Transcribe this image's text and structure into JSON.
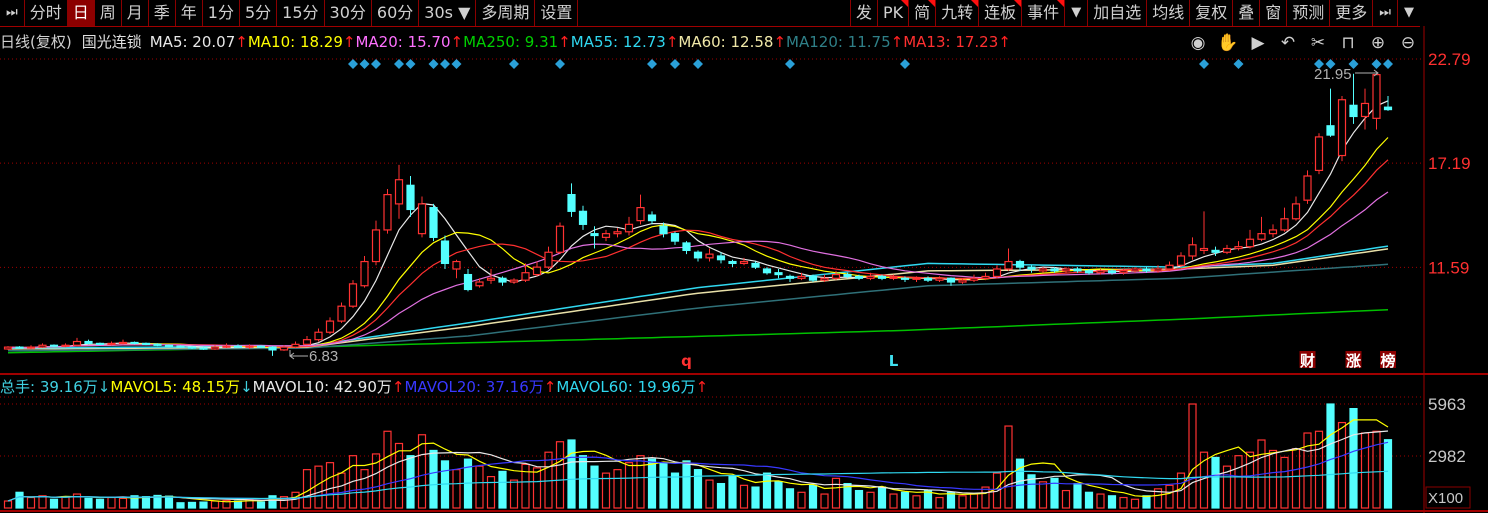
{
  "toolbar": {
    "left": [
      {
        "label": "⏭",
        "name": "collapse-sidebar-button",
        "icon": true
      },
      {
        "label": "分时",
        "name": "tab-intraday"
      },
      {
        "label": "日",
        "name": "tab-daily",
        "active": true
      },
      {
        "label": "周",
        "name": "tab-weekly"
      },
      {
        "label": "月",
        "name": "tab-monthly"
      },
      {
        "label": "季",
        "name": "tab-quarterly"
      },
      {
        "label": "年",
        "name": "tab-yearly"
      },
      {
        "label": "1分",
        "name": "tab-1min"
      },
      {
        "label": "5分",
        "name": "tab-5min"
      },
      {
        "label": "15分",
        "name": "tab-15min"
      },
      {
        "label": "30分",
        "name": "tab-30min"
      },
      {
        "label": "60分",
        "name": "tab-60min"
      },
      {
        "label": "30s   ▼",
        "name": "period-dropdown"
      },
      {
        "label": "多周期",
        "name": "multi-period-button"
      },
      {
        "label": "设置",
        "name": "settings-button"
      }
    ],
    "right": [
      {
        "label": "发",
        "name": "publish-button"
      },
      {
        "label": "PK",
        "name": "pk-button",
        "flag": true
      },
      {
        "label": "简",
        "name": "simple-button",
        "flag": true
      },
      {
        "label": "九转",
        "name": "nine-turn-button",
        "flag": true
      },
      {
        "label": "连板",
        "name": "consecutive-limit-button",
        "flag": true
      },
      {
        "label": "事件",
        "name": "events-button",
        "flag": true
      },
      {
        "label": "▼",
        "name": "more-dropdown",
        "icon": true
      },
      {
        "label": "加自选",
        "name": "add-watchlist-button"
      },
      {
        "label": "均线",
        "name": "moving-average-button"
      },
      {
        "label": "复权",
        "name": "adjust-button"
      },
      {
        "label": "叠",
        "name": "overlay-button"
      },
      {
        "label": "窗",
        "name": "window-button"
      },
      {
        "label": "预测",
        "name": "forecast-button"
      },
      {
        "label": "更多",
        "name": "more-button"
      },
      {
        "label": "⏭",
        "name": "expand-panel-button",
        "icon": true
      },
      {
        "label": "▼",
        "name": "panel-dropdown",
        "icon": true
      }
    ]
  },
  "price_legend": {
    "period": "日线(复权)",
    "stock": "国光连锁",
    "items": [
      {
        "label": "MA5: 20.07",
        "arrow": "↑",
        "dir": "up",
        "color": "#e8e8e8"
      },
      {
        "label": "MA10: 18.29",
        "arrow": "↑",
        "dir": "up",
        "color": "#ffff00"
      },
      {
        "label": "MA20: 15.70",
        "arrow": "↑",
        "dir": "up",
        "color": "#ff70ff"
      },
      {
        "label": "MA250: 9.31",
        "arrow": "↑",
        "dir": "up",
        "color": "#00d000"
      },
      {
        "label": "MA55: 12.73",
        "arrow": "↑",
        "dir": "up",
        "color": "#30d8f0"
      },
      {
        "label": "MA60: 12.58",
        "arrow": "↑",
        "dir": "up",
        "color": "#f0e8a8"
      },
      {
        "label": "MA120: 11.75",
        "arrow": "↑",
        "dir": "up",
        "color": "#2f8088"
      },
      {
        "label": "MA13: 17.23",
        "arrow": "↑",
        "dir": "up",
        "color": "#ff3030"
      }
    ]
  },
  "tools": [
    {
      "name": "eye-icon",
      "glyph": "◉"
    },
    {
      "name": "hand-icon",
      "glyph": "✋"
    },
    {
      "name": "play-icon",
      "glyph": "▶"
    },
    {
      "name": "undo-icon",
      "glyph": "↶"
    },
    {
      "name": "scissors-icon",
      "glyph": "✂"
    },
    {
      "name": "lock-icon",
      "glyph": "⊓"
    },
    {
      "name": "zoom-in-icon",
      "glyph": "⊕"
    },
    {
      "name": "zoom-out-icon",
      "glyph": "⊖"
    }
  ],
  "vol_legend": {
    "items": [
      {
        "label": "总手: 39.16万",
        "arrow": "↓",
        "dir": "down",
        "color": "#40d0e0"
      },
      {
        "label": "MAVOL5: 48.15万",
        "arrow": "↓",
        "dir": "down",
        "color": "#ffff00"
      },
      {
        "label": "MAVOL10: 42.90万",
        "arrow": "↑",
        "dir": "up",
        "color": "#e8e8e8"
      },
      {
        "label": "MAVOL20: 37.16万",
        "arrow": "↑",
        "dir": "up",
        "color": "#3838ff"
      },
      {
        "label": "MAVOL60: 19.96万",
        "arrow": "↑",
        "dir": "up",
        "color": "#30d8f0"
      }
    ]
  },
  "colors": {
    "up": "#ff3232",
    "down": "#54ffff",
    "grid": "#a00000",
    "axis_text": "#ff3030",
    "vol_axis_text": "#c8c8c8"
  },
  "chart_data": {
    "type": "candlestick",
    "price_axis": {
      "ticks": [
        "22.79",
        "17.19",
        "11.59"
      ],
      "tick_values": [
        22.79,
        17.19,
        11.59
      ]
    },
    "volume_axis": {
      "ticks": [
        "5963",
        "2982"
      ],
      "tick_values": [
        5963,
        2982
      ],
      "unit": "X100"
    },
    "high_label": "21.95",
    "low_label": "6.83",
    "bars_format": [
      "open",
      "close",
      "high",
      "low",
      "volume"
    ],
    "bars": [
      [
        7.2,
        7.3,
        7.35,
        7.15,
        400
      ],
      [
        7.3,
        7.25,
        7.35,
        7.2,
        900
      ],
      [
        7.25,
        7.3,
        7.4,
        7.2,
        600
      ],
      [
        7.3,
        7.4,
        7.5,
        7.25,
        700
      ],
      [
        7.4,
        7.35,
        7.45,
        7.3,
        500
      ],
      [
        7.35,
        7.4,
        7.5,
        7.3,
        650
      ],
      [
        7.4,
        7.6,
        7.8,
        7.35,
        800
      ],
      [
        7.6,
        7.5,
        7.7,
        7.45,
        550
      ],
      [
        7.5,
        7.45,
        7.55,
        7.4,
        500
      ],
      [
        7.45,
        7.5,
        7.6,
        7.4,
        600
      ],
      [
        7.5,
        7.55,
        7.7,
        7.45,
        550
      ],
      [
        7.55,
        7.5,
        7.6,
        7.45,
        700
      ],
      [
        7.5,
        7.45,
        7.55,
        7.4,
        650
      ],
      [
        7.45,
        7.4,
        7.5,
        7.35,
        720
      ],
      [
        7.4,
        7.35,
        7.45,
        7.3,
        680
      ],
      [
        7.35,
        7.3,
        7.4,
        7.25,
        300
      ],
      [
        7.3,
        7.25,
        7.35,
        7.2,
        320
      ],
      [
        7.25,
        7.2,
        7.3,
        7.15,
        340
      ],
      [
        7.2,
        7.3,
        7.4,
        7.15,
        400
      ],
      [
        7.3,
        7.35,
        7.5,
        7.25,
        420
      ],
      [
        7.35,
        7.3,
        7.45,
        7.25,
        400
      ],
      [
        7.3,
        7.35,
        7.45,
        7.2,
        500
      ],
      [
        7.35,
        7.3,
        7.4,
        7.25,
        350
      ],
      [
        7.3,
        7.15,
        7.35,
        6.83,
        700
      ],
      [
        7.15,
        7.3,
        7.4,
        7.1,
        650
      ],
      [
        7.3,
        7.45,
        7.6,
        7.25,
        900
      ],
      [
        7.45,
        7.7,
        7.9,
        7.4,
        2200
      ],
      [
        7.7,
        8.1,
        8.3,
        7.6,
        2400
      ],
      [
        8.1,
        8.7,
        8.9,
        8.0,
        2600
      ],
      [
        8.7,
        9.5,
        9.7,
        8.6,
        2000
      ],
      [
        9.5,
        10.7,
        10.9,
        9.4,
        3000
      ],
      [
        10.6,
        11.9,
        12.2,
        10.5,
        2200
      ],
      [
        11.9,
        13.6,
        14.1,
        11.7,
        3100
      ],
      [
        13.6,
        15.5,
        15.8,
        13.4,
        4400
      ],
      [
        15.0,
        16.3,
        17.1,
        14.2,
        3700
      ],
      [
        16.0,
        14.7,
        16.5,
        14.3,
        3000
      ],
      [
        13.4,
        15.0,
        15.4,
        13.2,
        4200
      ],
      [
        14.8,
        13.2,
        15.0,
        13.0,
        3300
      ],
      [
        13.0,
        11.8,
        13.3,
        11.5,
        2700
      ],
      [
        11.5,
        11.9,
        12.0,
        11.0,
        2200
      ],
      [
        11.2,
        10.4,
        11.5,
        10.3,
        2800
      ],
      [
        10.6,
        10.8,
        11.0,
        10.5,
        2400
      ],
      [
        10.9,
        11.0,
        11.5,
        10.7,
        1800
      ],
      [
        11.0,
        10.8,
        11.1,
        10.6,
        2100
      ],
      [
        10.8,
        10.9,
        11.0,
        10.7,
        1600
      ],
      [
        10.9,
        11.3,
        11.8,
        10.8,
        2500
      ],
      [
        11.2,
        11.6,
        11.9,
        11.1,
        2300
      ],
      [
        11.6,
        12.4,
        12.7,
        11.5,
        3200
      ],
      [
        12.4,
        13.8,
        14.0,
        12.3,
        3800
      ],
      [
        15.5,
        14.6,
        16.1,
        14.3,
        3900
      ],
      [
        14.6,
        13.9,
        14.9,
        13.6,
        3000
      ],
      [
        13.4,
        13.3,
        13.8,
        12.6,
        2400
      ],
      [
        13.2,
        13.4,
        13.6,
        13.0,
        2000
      ],
      [
        13.4,
        13.5,
        13.7,
        13.2,
        2200
      ],
      [
        13.5,
        13.9,
        14.3,
        13.3,
        2600
      ],
      [
        14.1,
        14.8,
        15.5,
        13.9,
        3000
      ],
      [
        14.4,
        14.1,
        14.6,
        13.9,
        2800
      ],
      [
        13.8,
        13.4,
        14.0,
        13.2,
        2600
      ],
      [
        13.4,
        13.0,
        13.5,
        12.8,
        2000
      ],
      [
        12.9,
        12.5,
        13.0,
        12.3,
        2700
      ],
      [
        12.4,
        12.1,
        12.5,
        11.9,
        2200
      ],
      [
        12.1,
        12.3,
        12.6,
        11.9,
        1600
      ],
      [
        12.2,
        12.0,
        12.4,
        11.8,
        1400
      ],
      [
        11.9,
        11.8,
        12.0,
        11.6,
        1800
      ],
      [
        11.8,
        11.9,
        12.1,
        11.7,
        1300
      ],
      [
        11.8,
        11.6,
        11.9,
        11.5,
        1200
      ],
      [
        11.5,
        11.3,
        11.6,
        11.2,
        2000
      ],
      [
        11.3,
        11.2,
        11.5,
        11.0,
        1500
      ],
      [
        11.1,
        11.0,
        11.2,
        10.8,
        1100
      ],
      [
        11.0,
        11.1,
        11.3,
        10.9,
        900
      ],
      [
        11.1,
        10.9,
        11.2,
        10.8,
        1300
      ],
      [
        10.9,
        11.0,
        11.2,
        10.8,
        800
      ],
      [
        11.0,
        11.2,
        11.4,
        10.9,
        1700
      ],
      [
        11.2,
        11.1,
        11.3,
        11.0,
        1400
      ],
      [
        11.1,
        11.0,
        11.2,
        10.9,
        1000
      ],
      [
        11.0,
        11.1,
        11.3,
        10.9,
        900
      ],
      [
        11.1,
        11.0,
        11.2,
        10.9,
        1200
      ],
      [
        11.0,
        11.05,
        11.2,
        10.9,
        800
      ],
      [
        11.0,
        10.95,
        11.1,
        10.8,
        900
      ],
      [
        10.95,
        11.0,
        11.1,
        10.8,
        700
      ],
      [
        11.0,
        10.9,
        11.1,
        10.8,
        1000
      ],
      [
        10.9,
        11.0,
        11.1,
        10.8,
        600
      ],
      [
        11.0,
        10.8,
        11.05,
        10.6,
        900
      ],
      [
        10.8,
        10.9,
        11.0,
        10.7,
        700
      ],
      [
        10.9,
        11.0,
        11.2,
        10.8,
        800
      ],
      [
        11.0,
        11.1,
        11.3,
        10.9,
        1200
      ],
      [
        11.1,
        11.5,
        11.7,
        11.0,
        2000
      ],
      [
        11.5,
        11.9,
        12.6,
        11.4,
        4700
      ],
      [
        11.9,
        11.6,
        12.0,
        11.4,
        2800
      ],
      [
        11.6,
        11.5,
        11.7,
        11.3,
        1900
      ],
      [
        11.4,
        11.5,
        11.6,
        11.3,
        1500
      ],
      [
        11.5,
        11.4,
        11.6,
        11.3,
        1700
      ],
      [
        11.4,
        11.5,
        11.6,
        11.3,
        1000
      ],
      [
        11.5,
        11.4,
        11.6,
        11.3,
        1400
      ],
      [
        11.4,
        11.3,
        11.5,
        11.2,
        900
      ],
      [
        11.3,
        11.4,
        11.5,
        11.2,
        800
      ],
      [
        11.4,
        11.3,
        11.5,
        11.2,
        700
      ],
      [
        11.3,
        11.4,
        11.5,
        11.2,
        600
      ],
      [
        11.4,
        11.5,
        11.6,
        11.3,
        500
      ],
      [
        11.5,
        11.4,
        11.6,
        11.3,
        700
      ],
      [
        11.4,
        11.5,
        11.7,
        11.3,
        1100
      ],
      [
        11.5,
        11.7,
        11.9,
        11.4,
        1300
      ],
      [
        11.7,
        12.2,
        12.4,
        11.6,
        2000
      ],
      [
        12.2,
        12.8,
        13.2,
        12.0,
        5963
      ],
      [
        12.5,
        12.6,
        14.6,
        12.3,
        3200
      ],
      [
        12.5,
        12.4,
        12.7,
        12.2,
        2900
      ],
      [
        12.4,
        12.6,
        12.8,
        12.3,
        2400
      ],
      [
        12.6,
        12.7,
        13.0,
        12.5,
        3000
      ],
      [
        12.7,
        13.1,
        13.6,
        12.6,
        3200
      ],
      [
        13.1,
        13.4,
        14.3,
        13.0,
        3900
      ],
      [
        13.4,
        13.6,
        13.9,
        13.2,
        3300
      ],
      [
        13.6,
        14.2,
        14.8,
        13.5,
        2900
      ],
      [
        14.2,
        15.0,
        15.4,
        14.1,
        3400
      ],
      [
        15.2,
        16.5,
        16.8,
        15.0,
        4300
      ],
      [
        16.8,
        18.6,
        18.8,
        16.6,
        4400
      ],
      [
        19.2,
        18.7,
        21.2,
        18.6,
        5963
      ],
      [
        17.6,
        20.6,
        20.8,
        17.3,
        4900
      ],
      [
        20.3,
        19.7,
        22.0,
        19.3,
        5700
      ],
      [
        19.7,
        20.4,
        21.2,
        19.0,
        4300
      ],
      [
        19.6,
        21.95,
        21.95,
        19.0,
        4400
      ],
      [
        20.2,
        20.07,
        20.8,
        20.0,
        3916
      ]
    ],
    "short_ma": [
      {
        "name": "MA5",
        "period": 5,
        "color": "#e8e8e8"
      },
      {
        "name": "MA10",
        "period": 10,
        "color": "#ffff00"
      },
      {
        "name": "MA13",
        "period": 13,
        "color": "#ff3030"
      },
      {
        "name": "MA20",
        "period": 20,
        "color": "#e070e0"
      }
    ],
    "long_ma": [
      {
        "name": "MA250",
        "color": "#00c000",
        "points": [
          [
            0,
            7.0
          ],
          [
            26,
            7.3
          ],
          [
            50,
            7.7
          ],
          [
            78,
            8.2
          ],
          [
            102,
            8.8
          ],
          [
            120,
            9.31
          ]
        ]
      },
      {
        "name": "MA120",
        "color": "#2f7078",
        "points": [
          [
            0,
            7.1
          ],
          [
            26,
            7.25
          ],
          [
            40,
            7.9
          ],
          [
            60,
            9.4
          ],
          [
            80,
            10.6
          ],
          [
            102,
            11.0
          ],
          [
            120,
            11.75
          ]
        ]
      },
      {
        "name": "MA60",
        "color": "#e8e0a8",
        "points": [
          [
            0,
            7.2
          ],
          [
            26,
            7.3
          ],
          [
            40,
            8.4
          ],
          [
            60,
            10.2
          ],
          [
            80,
            11.4
          ],
          [
            102,
            11.5
          ],
          [
            110,
            11.7
          ],
          [
            120,
            12.58
          ]
        ]
      },
      {
        "name": "MA55",
        "color": "#30d8f0",
        "points": [
          [
            0,
            7.25
          ],
          [
            26,
            7.35
          ],
          [
            40,
            8.6
          ],
          [
            60,
            10.5
          ],
          [
            80,
            11.8
          ],
          [
            102,
            11.6
          ],
          [
            110,
            11.8
          ],
          [
            120,
            12.73
          ]
        ]
      }
    ],
    "vol_ma": [
      {
        "name": "MAVOL5",
        "period": 5,
        "color": "#ffff00"
      },
      {
        "name": "MAVOL10",
        "period": 10,
        "color": "#e8e8e8"
      },
      {
        "name": "MAVOL20",
        "period": 20,
        "color": "#3838ff"
      },
      {
        "name": "MAVOL60",
        "period": 60,
        "color": "#30d8f0"
      }
    ],
    "signal_markers": [
      30,
      31,
      32,
      34,
      35,
      37,
      38,
      39,
      44,
      48,
      56,
      58,
      60,
      68,
      78,
      104,
      107,
      114,
      115,
      117,
      119,
      120
    ],
    "event_labels": [
      {
        "bar": 59,
        "text": "q",
        "color": "#ff3030",
        "boxed": false
      },
      {
        "bar": 77,
        "text": "L",
        "color": "#40e0f0",
        "boxed": false
      },
      {
        "bar": 113,
        "text": "财",
        "color": "#ffffff",
        "boxed": true
      },
      {
        "bar": 117,
        "text": "涨",
        "color": "#ffffff",
        "boxed": true
      },
      {
        "bar": 120,
        "text": "榜",
        "color": "#ffffff",
        "boxed": true
      }
    ]
  }
}
